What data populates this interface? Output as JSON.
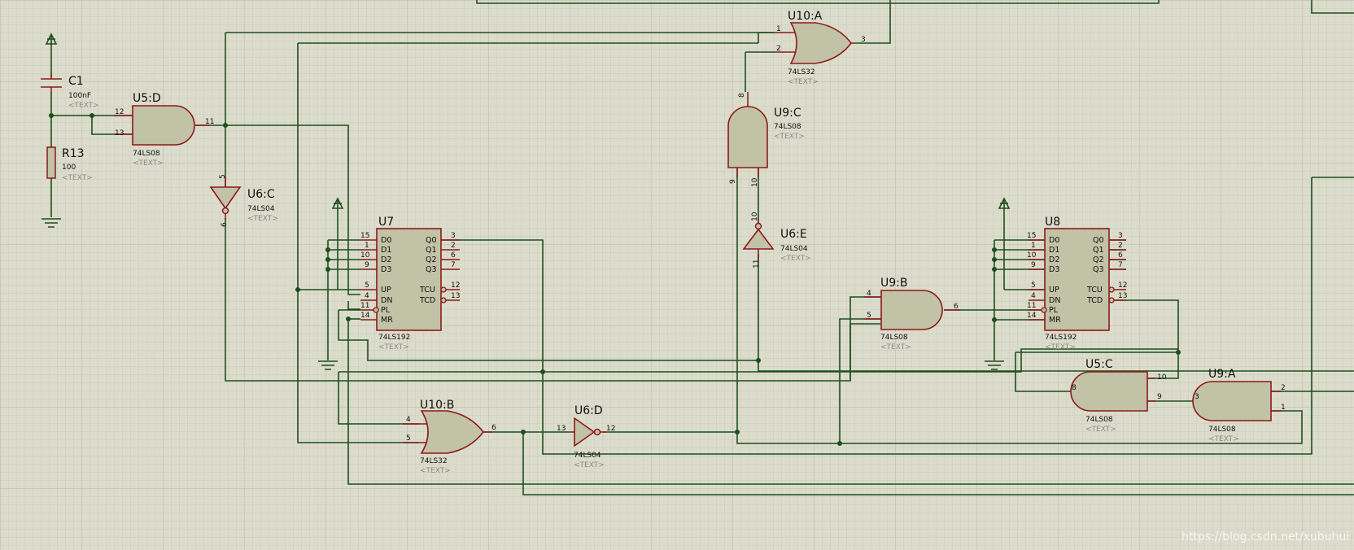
{
  "components": {
    "C1": {
      "ref": "C1",
      "value": "100nF",
      "text": "<TEXT>"
    },
    "R13": {
      "ref": "R13",
      "value": "100",
      "text": "<TEXT>"
    },
    "U5D": {
      "ref": "U5:D",
      "part": "74LS08",
      "text": "<TEXT>",
      "pins": [
        "12",
        "13",
        "11"
      ]
    },
    "U6C": {
      "ref": "U6:C",
      "part": "74LS04",
      "text": "<TEXT>",
      "pins": [
        "5",
        "6"
      ]
    },
    "U10A": {
      "ref": "U10:A",
      "part": "74LS32",
      "text": "<TEXT>",
      "pins": [
        "1",
        "2",
        "3"
      ]
    },
    "U9C": {
      "ref": "U9:C",
      "part": "74LS08",
      "text": "<TEXT>",
      "pins": [
        "8",
        "9",
        "10"
      ]
    },
    "U6E": {
      "ref": "U6:E",
      "part": "74LS04",
      "text": "<TEXT>",
      "pins": [
        "10",
        "11"
      ]
    },
    "U7": {
      "ref": "U7",
      "part": "74LS192",
      "text": "<TEXT>",
      "left_pins": [
        [
          "15",
          "D0"
        ],
        [
          "1",
          "D1"
        ],
        [
          "10",
          "D2"
        ],
        [
          "9",
          "D3"
        ],
        [
          "5",
          "UP"
        ],
        [
          "4",
          "DN"
        ],
        [
          "11",
          "PL"
        ],
        [
          "14",
          "MR"
        ]
      ],
      "right_pins": [
        [
          "3",
          "Q0"
        ],
        [
          "2",
          "Q1"
        ],
        [
          "6",
          "Q2"
        ],
        [
          "7",
          "Q3"
        ],
        [
          "12",
          "TCU"
        ],
        [
          "13",
          "TCD"
        ]
      ]
    },
    "U8": {
      "ref": "U8",
      "part": "74LS192",
      "text": "<TEXT>",
      "left_pins": [
        [
          "15",
          "D0"
        ],
        [
          "1",
          "D1"
        ],
        [
          "10",
          "D2"
        ],
        [
          "9",
          "D3"
        ],
        [
          "5",
          "UP"
        ],
        [
          "4",
          "DN"
        ],
        [
          "11",
          "PL"
        ],
        [
          "14",
          "MR"
        ]
      ],
      "right_pins": [
        [
          "3",
          "Q0"
        ],
        [
          "2",
          "Q1"
        ],
        [
          "6",
          "Q2"
        ],
        [
          "7",
          "Q3"
        ],
        [
          "12",
          "TCU"
        ],
        [
          "13",
          "TCD"
        ]
      ]
    },
    "U9B": {
      "ref": "U9:B",
      "part": "74LS08",
      "text": "<TEXT>",
      "pins": [
        "4",
        "5",
        "6"
      ]
    },
    "U10B": {
      "ref": "U10:B",
      "part": "74LS32",
      "text": "<TEXT>",
      "pins": [
        "4",
        "5",
        "6"
      ]
    },
    "U6D": {
      "ref": "U6:D",
      "part": "74LS04",
      "text": "<TEXT>",
      "pins": [
        "13",
        "12"
      ]
    },
    "U5C": {
      "ref": "U5:C",
      "part": "74LS08",
      "text": "<TEXT>",
      "pins": [
        "8",
        "9",
        "10"
      ]
    },
    "U9A": {
      "ref": "U9:A",
      "part": "74LS08",
      "text": "<TEXT>",
      "pins": [
        "3",
        "1",
        "2"
      ]
    }
  },
  "watermark": "https://blog.csdn.net/xubuhui",
  "colors": {
    "background": "#dcdccc",
    "grid": "#c8c8b6",
    "wire": "#1d4f1d",
    "outline": "#8b1a1a",
    "body": "#c2c2a6"
  }
}
